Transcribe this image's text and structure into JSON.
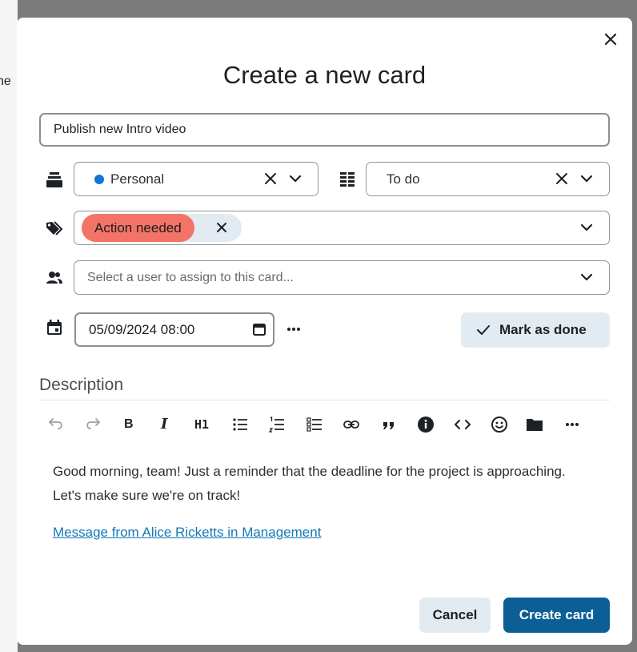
{
  "background": {
    "fragment_text": "he"
  },
  "modal": {
    "title": "Create a new card",
    "close_icon": "close-icon"
  },
  "card_title": {
    "value": "Publish new Intro video"
  },
  "board": {
    "icon": "stack-icon",
    "value": "Personal",
    "color": "#1177d1"
  },
  "column": {
    "icon": "columns-icon",
    "value": "To do"
  },
  "tags": {
    "icon": "tags-icon",
    "items": [
      {
        "label": "Action needed",
        "color": "#f37467"
      }
    ]
  },
  "assignee": {
    "icon": "users-icon",
    "placeholder": "Select a user to assign to this card..."
  },
  "due_date": {
    "icon": "calendar-icon",
    "value": "05/09/2024 08:00"
  },
  "mark_done": {
    "label": "Mark as done"
  },
  "description": {
    "label": "Description",
    "toolbar": [
      "undo-icon",
      "redo-icon",
      "bold",
      "italic",
      "H1",
      "bullet-list-icon",
      "numbered-list-icon",
      "checklist-icon",
      "link-icon",
      "quote-icon",
      "info-icon",
      "code-icon",
      "emoji-icon",
      "folder-icon",
      "more-icon"
    ],
    "bold_label": "B",
    "italic_label": "I",
    "h1_label": "H1",
    "text": "Good morning, team! Just a reminder that the deadline for the project is approaching. Let's make sure we're on track!",
    "link_text": "Message from Alice Ricketts in Management"
  },
  "buttons": {
    "cancel": "Cancel",
    "create": "Create card"
  },
  "colors": {
    "primary": "#0c5f96",
    "secondary": "#e3ebf2",
    "tag": "#f37467",
    "link": "#1479b8"
  }
}
